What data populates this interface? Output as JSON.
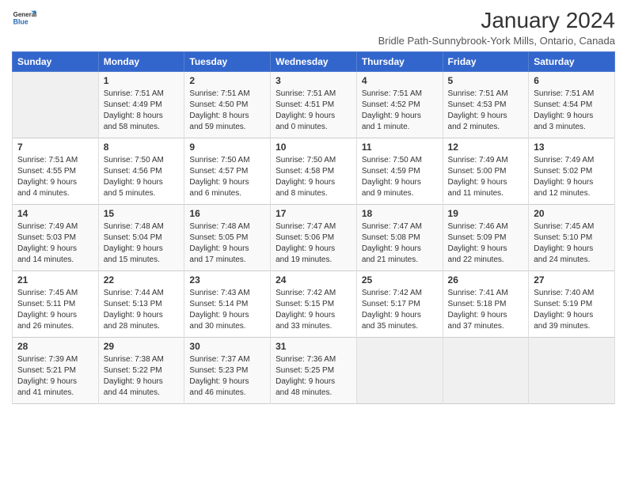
{
  "header": {
    "logo_line1": "General",
    "logo_line2": "Blue",
    "title": "January 2024",
    "subtitle": "Bridle Path-Sunnybrook-York Mills, Ontario, Canada"
  },
  "days_of_week": [
    "Sunday",
    "Monday",
    "Tuesday",
    "Wednesday",
    "Thursday",
    "Friday",
    "Saturday"
  ],
  "weeks": [
    [
      {
        "day": "",
        "info": ""
      },
      {
        "day": "1",
        "info": "Sunrise: 7:51 AM\nSunset: 4:49 PM\nDaylight: 8 hours\nand 58 minutes."
      },
      {
        "day": "2",
        "info": "Sunrise: 7:51 AM\nSunset: 4:50 PM\nDaylight: 8 hours\nand 59 minutes."
      },
      {
        "day": "3",
        "info": "Sunrise: 7:51 AM\nSunset: 4:51 PM\nDaylight: 9 hours\nand 0 minutes."
      },
      {
        "day": "4",
        "info": "Sunrise: 7:51 AM\nSunset: 4:52 PM\nDaylight: 9 hours\nand 1 minute."
      },
      {
        "day": "5",
        "info": "Sunrise: 7:51 AM\nSunset: 4:53 PM\nDaylight: 9 hours\nand 2 minutes."
      },
      {
        "day": "6",
        "info": "Sunrise: 7:51 AM\nSunset: 4:54 PM\nDaylight: 9 hours\nand 3 minutes."
      }
    ],
    [
      {
        "day": "7",
        "info": "Sunrise: 7:51 AM\nSunset: 4:55 PM\nDaylight: 9 hours\nand 4 minutes."
      },
      {
        "day": "8",
        "info": "Sunrise: 7:50 AM\nSunset: 4:56 PM\nDaylight: 9 hours\nand 5 minutes."
      },
      {
        "day": "9",
        "info": "Sunrise: 7:50 AM\nSunset: 4:57 PM\nDaylight: 9 hours\nand 6 minutes."
      },
      {
        "day": "10",
        "info": "Sunrise: 7:50 AM\nSunset: 4:58 PM\nDaylight: 9 hours\nand 8 minutes."
      },
      {
        "day": "11",
        "info": "Sunrise: 7:50 AM\nSunset: 4:59 PM\nDaylight: 9 hours\nand 9 minutes."
      },
      {
        "day": "12",
        "info": "Sunrise: 7:49 AM\nSunset: 5:00 PM\nDaylight: 9 hours\nand 11 minutes."
      },
      {
        "day": "13",
        "info": "Sunrise: 7:49 AM\nSunset: 5:02 PM\nDaylight: 9 hours\nand 12 minutes."
      }
    ],
    [
      {
        "day": "14",
        "info": "Sunrise: 7:49 AM\nSunset: 5:03 PM\nDaylight: 9 hours\nand 14 minutes."
      },
      {
        "day": "15",
        "info": "Sunrise: 7:48 AM\nSunset: 5:04 PM\nDaylight: 9 hours\nand 15 minutes."
      },
      {
        "day": "16",
        "info": "Sunrise: 7:48 AM\nSunset: 5:05 PM\nDaylight: 9 hours\nand 17 minutes."
      },
      {
        "day": "17",
        "info": "Sunrise: 7:47 AM\nSunset: 5:06 PM\nDaylight: 9 hours\nand 19 minutes."
      },
      {
        "day": "18",
        "info": "Sunrise: 7:47 AM\nSunset: 5:08 PM\nDaylight: 9 hours\nand 21 minutes."
      },
      {
        "day": "19",
        "info": "Sunrise: 7:46 AM\nSunset: 5:09 PM\nDaylight: 9 hours\nand 22 minutes."
      },
      {
        "day": "20",
        "info": "Sunrise: 7:45 AM\nSunset: 5:10 PM\nDaylight: 9 hours\nand 24 minutes."
      }
    ],
    [
      {
        "day": "21",
        "info": "Sunrise: 7:45 AM\nSunset: 5:11 PM\nDaylight: 9 hours\nand 26 minutes."
      },
      {
        "day": "22",
        "info": "Sunrise: 7:44 AM\nSunset: 5:13 PM\nDaylight: 9 hours\nand 28 minutes."
      },
      {
        "day": "23",
        "info": "Sunrise: 7:43 AM\nSunset: 5:14 PM\nDaylight: 9 hours\nand 30 minutes."
      },
      {
        "day": "24",
        "info": "Sunrise: 7:42 AM\nSunset: 5:15 PM\nDaylight: 9 hours\nand 33 minutes."
      },
      {
        "day": "25",
        "info": "Sunrise: 7:42 AM\nSunset: 5:17 PM\nDaylight: 9 hours\nand 35 minutes."
      },
      {
        "day": "26",
        "info": "Sunrise: 7:41 AM\nSunset: 5:18 PM\nDaylight: 9 hours\nand 37 minutes."
      },
      {
        "day": "27",
        "info": "Sunrise: 7:40 AM\nSunset: 5:19 PM\nDaylight: 9 hours\nand 39 minutes."
      }
    ],
    [
      {
        "day": "28",
        "info": "Sunrise: 7:39 AM\nSunset: 5:21 PM\nDaylight: 9 hours\nand 41 minutes."
      },
      {
        "day": "29",
        "info": "Sunrise: 7:38 AM\nSunset: 5:22 PM\nDaylight: 9 hours\nand 44 minutes."
      },
      {
        "day": "30",
        "info": "Sunrise: 7:37 AM\nSunset: 5:23 PM\nDaylight: 9 hours\nand 46 minutes."
      },
      {
        "day": "31",
        "info": "Sunrise: 7:36 AM\nSunset: 5:25 PM\nDaylight: 9 hours\nand 48 minutes."
      },
      {
        "day": "",
        "info": ""
      },
      {
        "day": "",
        "info": ""
      },
      {
        "day": "",
        "info": ""
      }
    ]
  ]
}
